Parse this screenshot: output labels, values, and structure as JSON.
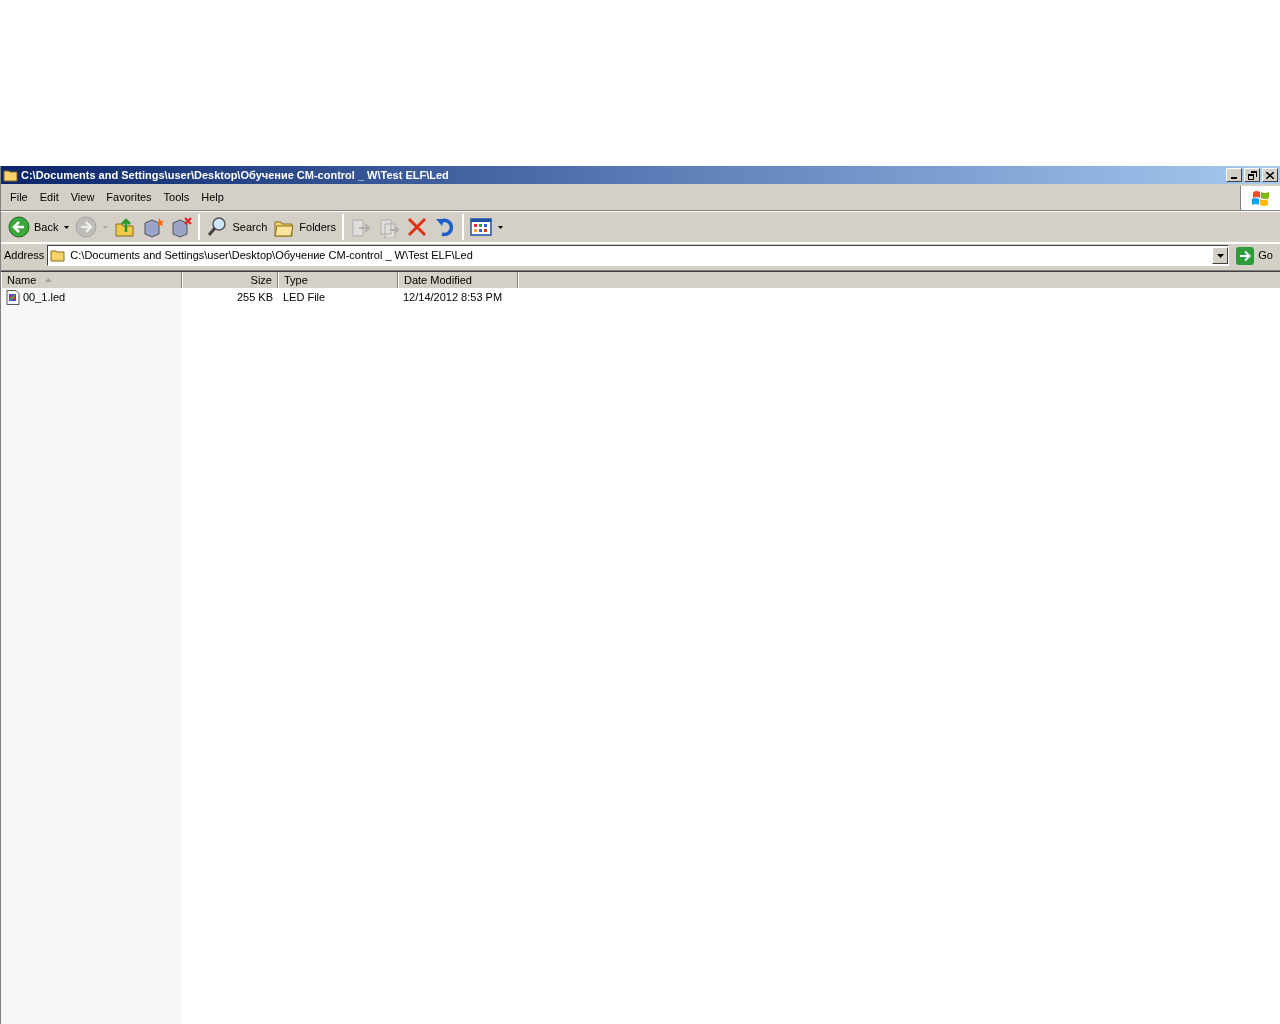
{
  "window": {
    "title": "C:\\Documents and Settings\\user\\Desktop\\Обучение CM-control _ W\\Test ELF\\Led"
  },
  "menu": [
    "File",
    "Edit",
    "View",
    "Favorites",
    "Tools",
    "Help"
  ],
  "toolbar_groups": [
    [
      {
        "label": "Back",
        "dropdown": true,
        "disabled": false
      },
      {
        "dropdown": true,
        "disabled": true
      },
      {
        "disabled": false
      },
      {
        "disabled": false
      },
      {
        "disabled": false
      }
    ],
    [
      {
        "label": "Search",
        "dropdown": false,
        "disabled": false
      },
      {
        "label": "Folders",
        "dropdown": false,
        "disabled": false
      }
    ],
    [
      {
        "disabled": true
      },
      {
        "disabled": true
      },
      {
        "disabled": false
      },
      {
        "disabled": false
      }
    ],
    [
      {
        "dropdown": true,
        "disabled": false
      }
    ]
  ],
  "address": {
    "label": "Address",
    "value": "C:\\Documents and Settings\\user\\Desktop\\Обучение CM-control _ W\\Test ELF\\Led",
    "go": "Go"
  },
  "columns": [
    {
      "label": "Name",
      "sorted": true
    },
    {
      "label": "Size",
      "sorted": false
    },
    {
      "label": "Type",
      "sorted": false
    },
    {
      "label": "Date Modified",
      "sorted": false
    }
  ],
  "rows": [
    {
      "cells": [
        "00_1.led",
        "255 KB",
        "LED File",
        "12/14/2012 8:53 PM"
      ]
    }
  ]
}
